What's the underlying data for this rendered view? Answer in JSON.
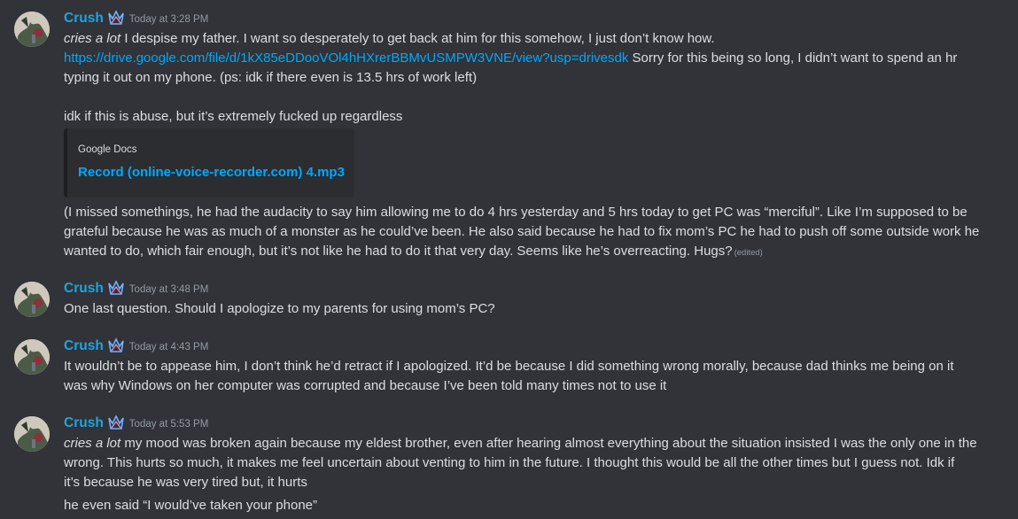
{
  "colors": {
    "background": "#313338",
    "username": "#1ea4df",
    "link": "#00a8fc",
    "text": "#dbdee1",
    "muted": "#949ba4",
    "embed_bg": "#2b2d31"
  },
  "messages": [
    {
      "username": "Crush",
      "role_icon": "crown-badge-icon",
      "timestamp": "Today at 3:28 PM",
      "line1_italic": "cries a lot",
      "line1_text": " I despise my father. I want so desperately to get back at him for this somehow, I just don’t know how.",
      "line2_link": "https://drive.google.com/file/d/1kX85eDDooVOl4hHXrerBBMvUSMPW3VNE/view?usp=drivesdk",
      "line2_text": " Sorry for this being so long, I didn’t want to spend an hr",
      "line3_text": "typing it out on my phone. (ps: idk if there even is 13.5 hrs of work left)",
      "line4_text": "idk if this is abuse, but it’s extremely fucked up regardless",
      "embed": {
        "provider": "Google Docs",
        "title": "Record (online-voice-recorder.com) 4.mp3"
      },
      "line5_text": "(I missed somethings, he had the audacity to say him allowing me to do 4 hrs yesterday and 5 hrs today to get PC was “merciful”. Like I’m supposed to be",
      "line6_text": "grateful because he was as much of a monster as he could’ve been. He also said because he had to fix mom’s PC he had to push off some outside work he",
      "line7_text": "wanted to do, which fair enough, but it’s not like he had to do it that very day. Seems like he’s overreacting. Hugs?",
      "edited": "(edited)"
    },
    {
      "username": "Crush",
      "role_icon": "crown-badge-icon",
      "timestamp": "Today at 3:48 PM",
      "line1_text": "One last question. Should I apologize to my parents for using mom’s PC?"
    },
    {
      "username": "Crush",
      "role_icon": "crown-badge-icon",
      "timestamp": "Today at 4:43 PM",
      "line1_text": "It wouldn’t be to appease him, I don’t think he’d retract if I apologized. It’d be because I did something wrong morally, because dad thinks me being on it",
      "line2_text": "was why Windows on her computer was corrupted and because I’ve been told many times not to use it"
    },
    {
      "username": "Crush",
      "role_icon": "crown-badge-icon",
      "timestamp": "Today at 5:53 PM",
      "line1_italic": "cries a lot",
      "line1_text": " my mood was broken again because my eldest brother, even after hearing almost everything about the situation insisted I was the only one in the",
      "line2_text": "wrong. This hurts so much, it makes me feel uncertain about venting to him in the future. I thought this would be all the other times but I guess not. Idk if",
      "line3_text": "it’s because he was very tired but, it hurts",
      "line4_text": "he even said “I would’ve taken your phone”"
    }
  ]
}
